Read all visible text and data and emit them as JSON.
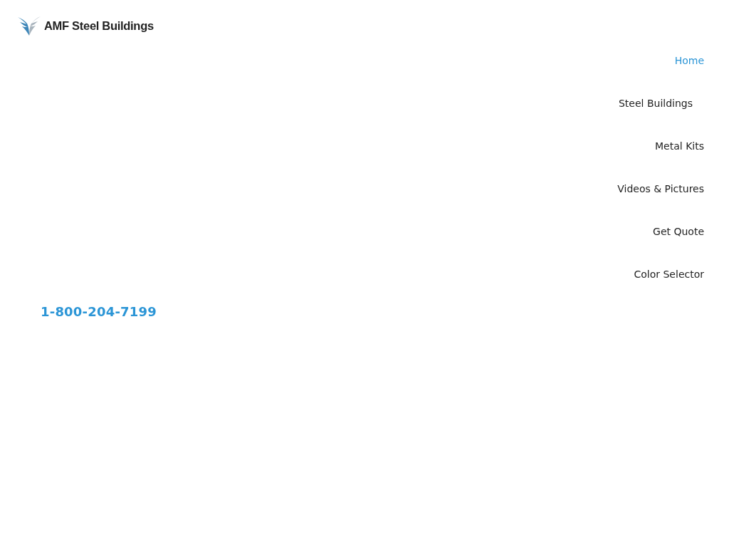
{
  "logo": {
    "text": "AMF Steel Buildings"
  },
  "nav": {
    "items": [
      {
        "label": "Home",
        "selected": true,
        "kind": "link"
      },
      {
        "label": "Steel Buildings",
        "selected": false,
        "kind": "dropdown"
      },
      {
        "label": "Metal Kits",
        "selected": false,
        "kind": "link"
      },
      {
        "label": "Videos & Pictures",
        "selected": false,
        "kind": "link"
      },
      {
        "label": "Get Quote",
        "selected": false,
        "kind": "link"
      },
      {
        "label": "Color Selector",
        "selected": false,
        "kind": "link"
      }
    ]
  },
  "phone": {
    "text": "1-800-204-7199"
  }
}
